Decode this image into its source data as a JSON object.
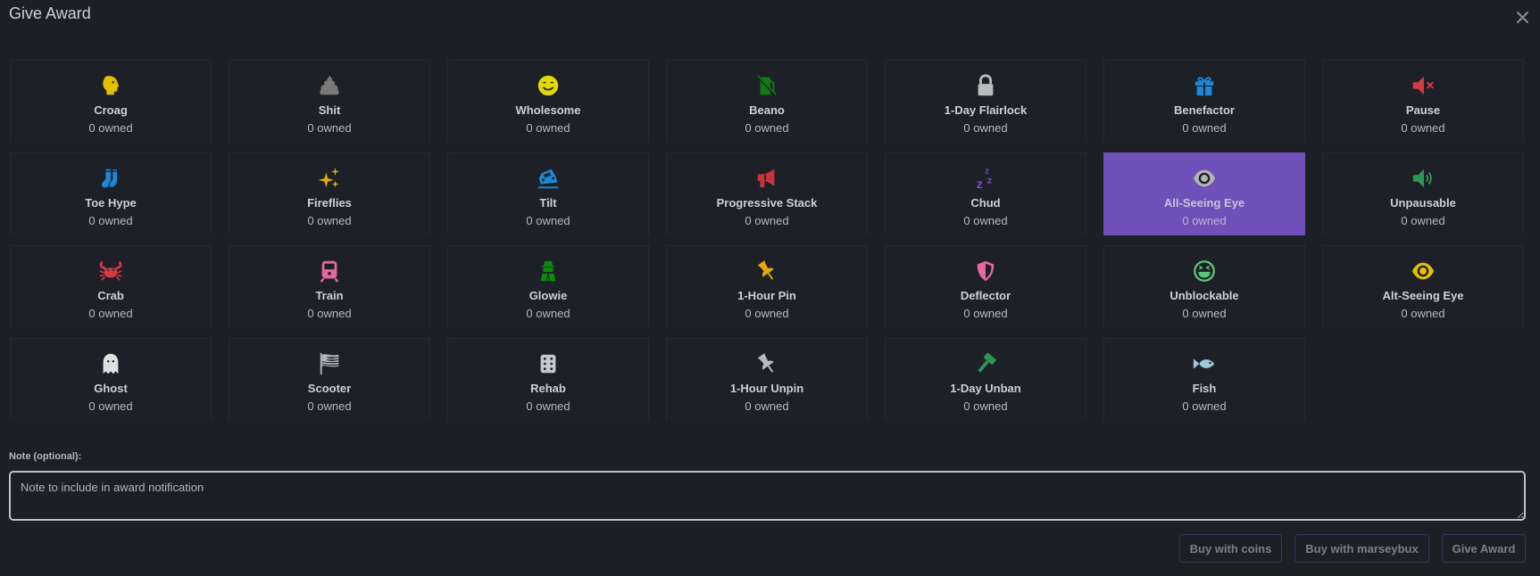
{
  "modal": {
    "title": "Give Award",
    "close_icon": "close-icon"
  },
  "awards": [
    {
      "name": "Croag",
      "owned": "0 owned",
      "icon": "head-side-icon",
      "color": "#e5bf03",
      "selected": false
    },
    {
      "name": "Shit",
      "owned": "0 owned",
      "icon": "poop-icon",
      "color": "#7a7a7a",
      "selected": false
    },
    {
      "name": "Wholesome",
      "owned": "0 owned",
      "icon": "smile-icon",
      "color": "#e5d903",
      "selected": false
    },
    {
      "name": "Beano",
      "owned": "0 owned",
      "icon": "gas-pump-slash-icon",
      "color": "#0f7d12",
      "selected": false
    },
    {
      "name": "1-Day Flairlock",
      "owned": "0 owned",
      "icon": "lock-icon",
      "color": "#b9bbbe",
      "selected": false
    },
    {
      "name": "Benefactor",
      "owned": "0 owned",
      "icon": "gift-icon",
      "color": "#1e88d6",
      "selected": false
    },
    {
      "name": "Pause",
      "owned": "0 owned",
      "icon": "volume-mute-icon",
      "color": "#d13a46",
      "selected": false
    },
    {
      "name": "Toe Hype",
      "owned": "0 owned",
      "icon": "socks-icon",
      "color": "#1e88d6",
      "selected": false
    },
    {
      "name": "Fireflies",
      "owned": "0 owned",
      "icon": "sparkles-icon",
      "color": "#e5a90b",
      "selected": false
    },
    {
      "name": "Tilt",
      "owned": "0 owned",
      "icon": "car-tilt-icon",
      "color": "#1e88d6",
      "selected": false
    },
    {
      "name": "Progressive Stack",
      "owned": "0 owned",
      "icon": "megaphone-icon",
      "color": "#c93440",
      "selected": false
    },
    {
      "name": "Chud",
      "owned": "0 owned",
      "icon": "snooze-icon",
      "color": "#7b4fc8",
      "selected": false
    },
    {
      "name": "All-Seeing Eye",
      "owned": "0 owned",
      "icon": "eye-icon",
      "color": "#b3b3b3",
      "selected": true
    },
    {
      "name": "Unpausable",
      "owned": "0 owned",
      "icon": "volume-up-icon",
      "color": "#2e9556",
      "selected": false
    },
    {
      "name": "Crab",
      "owned": "0 owned",
      "icon": "crab-icon",
      "color": "#d13a46",
      "selected": false
    },
    {
      "name": "Train",
      "owned": "0 owned",
      "icon": "train-icon",
      "color": "#e566a3",
      "selected": false
    },
    {
      "name": "Glowie",
      "owned": "0 owned",
      "icon": "spy-icon",
      "color": "#0c8a0c",
      "selected": false
    },
    {
      "name": "1-Hour Pin",
      "owned": "0 owned",
      "icon": "thumbtack-icon",
      "color": "#e5a90b",
      "selected": false
    },
    {
      "name": "Deflector",
      "owned": "0 owned",
      "icon": "shield-icon",
      "color": "#e566a3",
      "selected": false
    },
    {
      "name": "Unblockable",
      "owned": "0 owned",
      "icon": "laugh-squint-icon",
      "color": "#5cc47a",
      "selected": false
    },
    {
      "name": "Alt-Seeing Eye",
      "owned": "0 owned",
      "icon": "eye-icon",
      "color": "#e5bf03",
      "selected": false
    },
    {
      "name": "Ghost",
      "owned": "0 owned",
      "icon": "ghost-icon",
      "color": "#e0e0e0",
      "selected": false
    },
    {
      "name": "Scooter",
      "owned": "0 owned",
      "icon": "flag-usa-icon",
      "color": "#b3b5b8",
      "selected": false
    },
    {
      "name": "Rehab",
      "owned": "0 owned",
      "icon": "dice-icon",
      "color": "#c6c8cb",
      "selected": false
    },
    {
      "name": "1-Hour Unpin",
      "owned": "0 owned",
      "icon": "thumbtack-icon",
      "color": "#b9bbc2",
      "selected": false
    },
    {
      "name": "1-Day Unban",
      "owned": "0 owned",
      "icon": "gavel-icon",
      "color": "#2e9556",
      "selected": false
    },
    {
      "name": "Fish",
      "owned": "0 owned",
      "icon": "fish-icon",
      "color": "#9fc7d8",
      "selected": false
    }
  ],
  "note": {
    "label": "Note (optional):",
    "value": "",
    "placeholder": "Note to include in award notification"
  },
  "buttons": {
    "buy_coins": "Buy with coins",
    "buy_marseybux": "Buy with marseybux",
    "give_award": "Give Award"
  },
  "colors": {
    "background": "#1c1f24",
    "selected": "#6f4fb8",
    "button_border": "#3a355d"
  }
}
